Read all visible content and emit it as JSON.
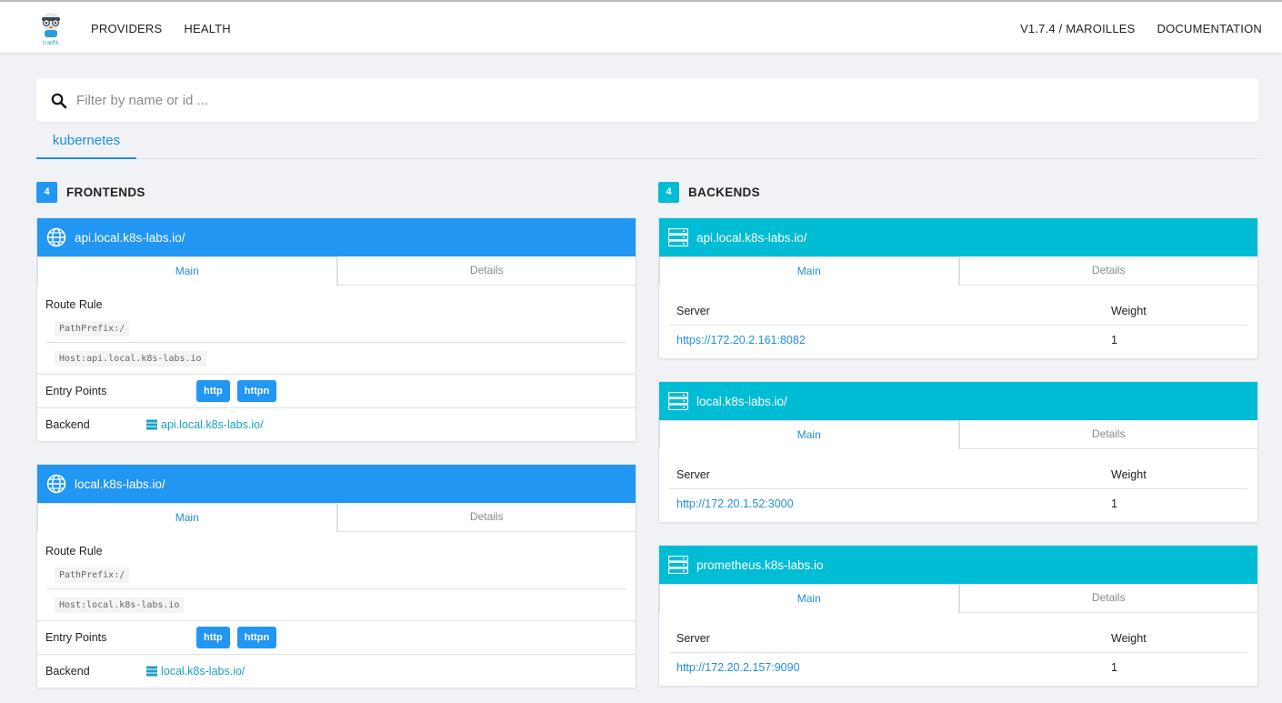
{
  "nav": {
    "logo_text": "træfik",
    "left": [
      "PROVIDERS",
      "HEALTH"
    ],
    "right": [
      "V1.7.4 / MAROILLES",
      "DOCUMENTATION"
    ]
  },
  "search": {
    "placeholder": "Filter by name or id ..."
  },
  "provider_tabs": [
    "kubernetes"
  ],
  "frontends": {
    "count": "4",
    "title": "FRONTENDS",
    "items": [
      {
        "name": "api.local.k8s-labs.io/",
        "tabs": [
          "Main",
          "Details"
        ],
        "route_rule_label": "Route Rule",
        "rules": [
          "PathPrefix:/",
          "Host:api.local.k8s-labs.io"
        ],
        "entry_points_label": "Entry Points",
        "entry_points": [
          "http",
          "httpn"
        ],
        "backend_label": "Backend",
        "backend": "api.local.k8s-labs.io/"
      },
      {
        "name": "local.k8s-labs.io/",
        "tabs": [
          "Main",
          "Details"
        ],
        "route_rule_label": "Route Rule",
        "rules": [
          "PathPrefix:/",
          "Host:local.k8s-labs.io"
        ],
        "entry_points_label": "Entry Points",
        "entry_points": [
          "http",
          "httpn"
        ],
        "backend_label": "Backend",
        "backend": "local.k8s-labs.io/"
      }
    ]
  },
  "backends": {
    "count": "4",
    "title": "BACKENDS",
    "items": [
      {
        "name": "api.local.k8s-labs.io/",
        "tabs": [
          "Main",
          "Details"
        ],
        "col_server": "Server",
        "col_weight": "Weight",
        "server": "https://172.20.2.161:8082",
        "weight": "1"
      },
      {
        "name": "local.k8s-labs.io/",
        "tabs": [
          "Main",
          "Details"
        ],
        "col_server": "Server",
        "col_weight": "Weight",
        "server": "http://172.20.1.52:3000",
        "weight": "1"
      },
      {
        "name": "prometheus.k8s-labs.io",
        "tabs": [
          "Main",
          "Details"
        ],
        "col_server": "Server",
        "col_weight": "Weight",
        "server": "http://172.20.2.157:9090",
        "weight": "1"
      }
    ]
  },
  "colors": {
    "frontend": "#2196f3",
    "backend": "#00bcd4",
    "link": "#1f8ee0"
  },
  "icons": {
    "frontend": "globe-icon",
    "backend": "server-icon",
    "search": "search-icon"
  }
}
